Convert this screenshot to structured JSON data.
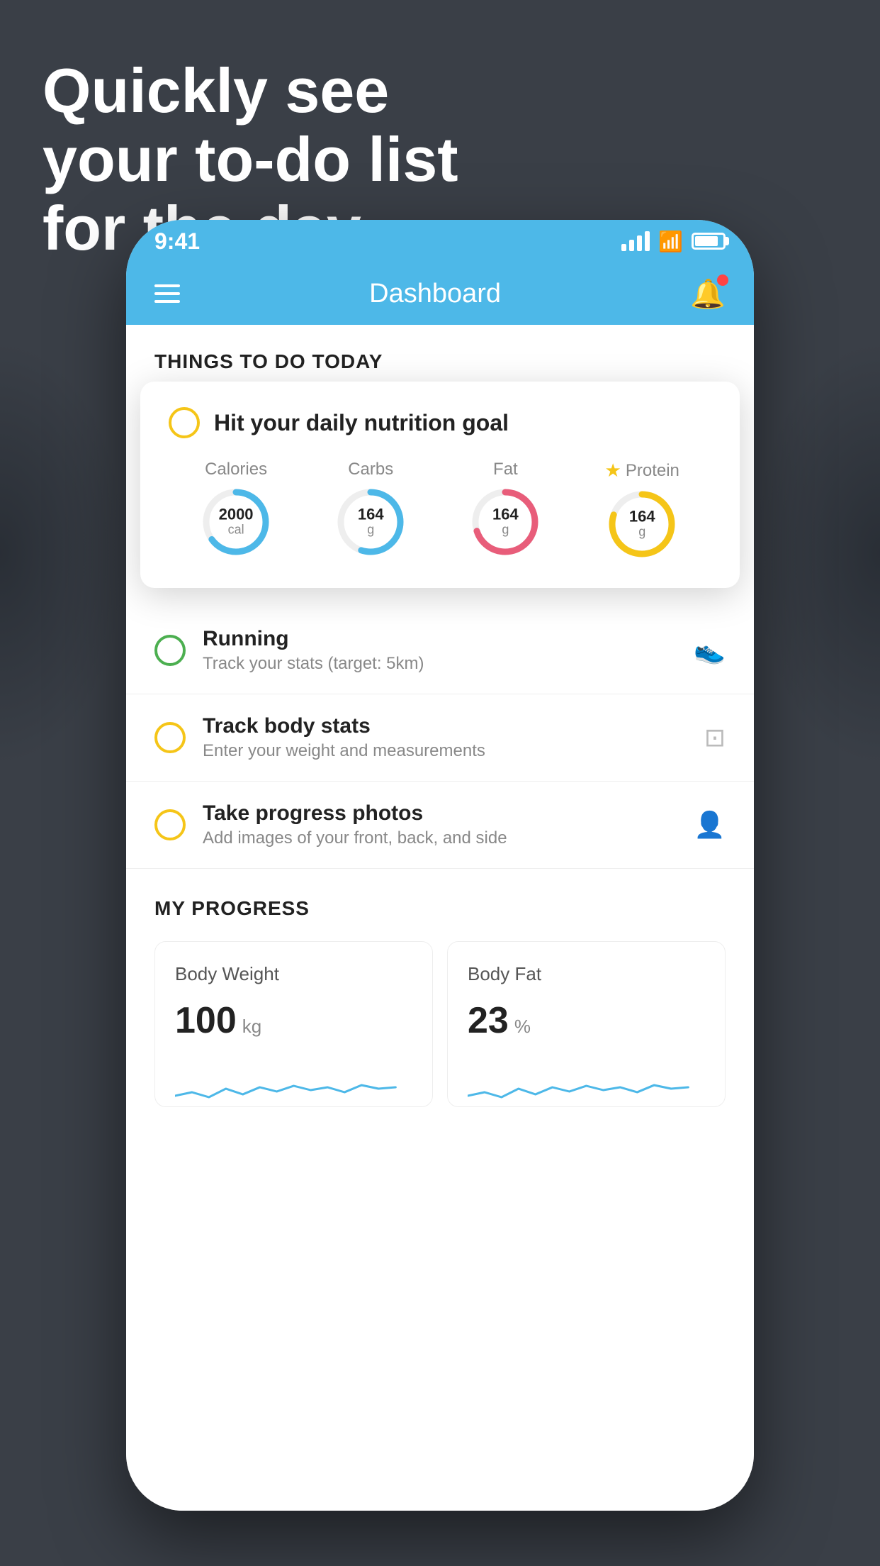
{
  "headline": {
    "line1": "Quickly see",
    "line2": "your to-do list",
    "line3": "for the day."
  },
  "status_bar": {
    "time": "9:41"
  },
  "header": {
    "title": "Dashboard"
  },
  "things_section": {
    "title": "THINGS TO DO TODAY"
  },
  "nutrition_card": {
    "title": "Hit your daily nutrition goal",
    "stats": [
      {
        "label": "Calories",
        "value": "2000",
        "unit": "cal",
        "color": "#4db8e8",
        "percent": 65
      },
      {
        "label": "Carbs",
        "value": "164",
        "unit": "g",
        "color": "#4db8e8",
        "percent": 55
      },
      {
        "label": "Fat",
        "value": "164",
        "unit": "g",
        "color": "#e85d7a",
        "percent": 70
      },
      {
        "label": "Protein",
        "value": "164",
        "unit": "g",
        "color": "#f5c518",
        "percent": 80
      }
    ]
  },
  "todo_items": [
    {
      "title": "Running",
      "subtitle": "Track your stats (target: 5km)",
      "circle_color": "green",
      "icon": "shoe"
    },
    {
      "title": "Track body stats",
      "subtitle": "Enter your weight and measurements",
      "circle_color": "yellow",
      "icon": "scale"
    },
    {
      "title": "Take progress photos",
      "subtitle": "Add images of your front, back, and side",
      "circle_color": "yellow",
      "icon": "person"
    }
  ],
  "progress_section": {
    "title": "MY PROGRESS",
    "cards": [
      {
        "title": "Body Weight",
        "value": "100",
        "unit": "kg"
      },
      {
        "title": "Body Fat",
        "value": "23",
        "unit": "%"
      }
    ]
  }
}
